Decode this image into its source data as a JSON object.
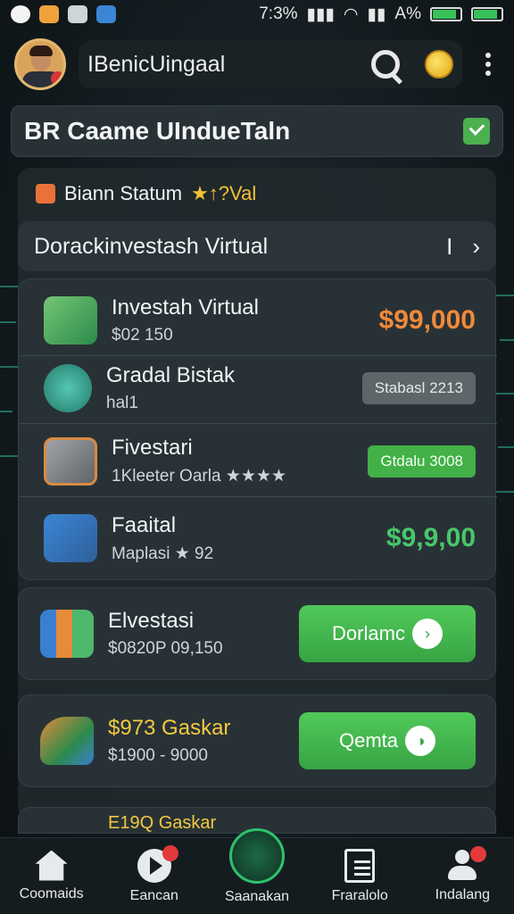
{
  "status_bar": {
    "time": "7:3%",
    "battery_pct": "A%"
  },
  "header": {
    "title": "IBenicUingaal"
  },
  "title_bar": {
    "title": "BR Caame UInduеTaln"
  },
  "status_line": {
    "label": "Biann Statum",
    "suffix": "★↑?Val"
  },
  "nav_row": {
    "label": "Dorackinvestash Virtual",
    "right_a": "I",
    "right_b": "›"
  },
  "list": [
    {
      "title": "Investah Virtual",
      "sub": "$02 150",
      "amount": "$99,000",
      "kind": "amount-orange"
    },
    {
      "title": "Gradal Bistak",
      "sub": "hal1",
      "tag": "Stabasl 2213",
      "kind": "tag-grey"
    },
    {
      "title": "Fivestari",
      "sub": "1Kleeter Oarla ★★★★",
      "tag": "Gtdalu 3008",
      "kind": "tag-green"
    },
    {
      "title": "Faaital",
      "sub": "Maplasi ★ 92",
      "amount": "$9,9,00",
      "kind": "amount-green"
    }
  ],
  "action_cards": [
    {
      "title": "Elvestasi",
      "sub": "$0820P 09,150",
      "button": "Dorlamc",
      "button_icon": "›"
    },
    {
      "title": "$973 Gaskar",
      "sub": "$1900 - 9000",
      "button": "Qemta",
      "button_icon": "◑"
    }
  ],
  "peek_text": "E19Q Gaskar",
  "bottom_nav": [
    {
      "label": "Coomaids",
      "icon": "home-icon"
    },
    {
      "label": "Eancan",
      "icon": "play-icon"
    },
    {
      "label": "Saanakan",
      "icon": "center-icon"
    },
    {
      "label": "Fraralolo",
      "icon": "document-icon"
    },
    {
      "label": "Indalang",
      "icon": "user-icon"
    }
  ],
  "colors": {
    "accent_green": "#48c76a",
    "accent_orange": "#f08a3a",
    "gold": "#f3c941"
  }
}
